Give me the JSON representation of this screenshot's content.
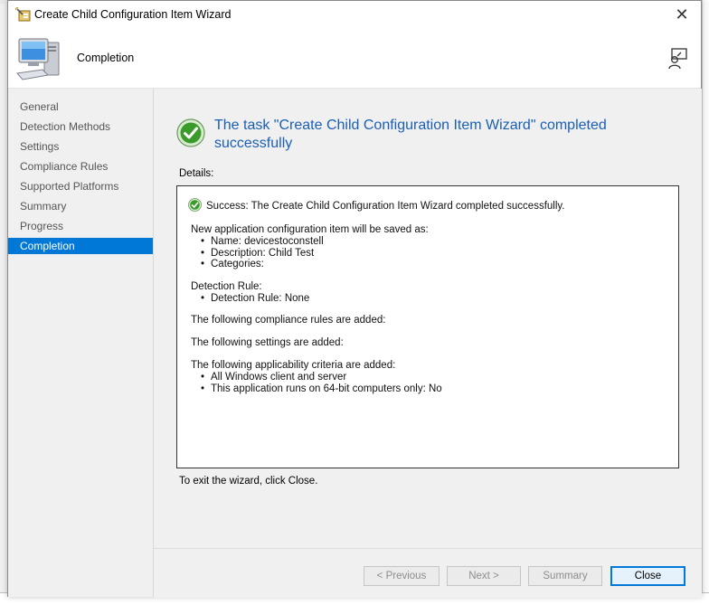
{
  "window": {
    "title": "Create Child Configuration Item Wizard",
    "close_glyph": "✕"
  },
  "header": {
    "page_title": "Completion"
  },
  "nav": {
    "items": [
      {
        "label": "General"
      },
      {
        "label": "Detection Methods"
      },
      {
        "label": "Settings"
      },
      {
        "label": "Compliance Rules"
      },
      {
        "label": "Supported Platforms"
      },
      {
        "label": "Summary"
      },
      {
        "label": "Progress"
      },
      {
        "label": "Completion",
        "active": true
      }
    ]
  },
  "main": {
    "status_title": "The task \"Create Child Configuration Item Wizard\" completed successfully",
    "details_label": "Details:",
    "details": {
      "success_text": "Success: The Create Child Configuration Item Wizard completed successfully.",
      "saved_as": {
        "heading": "New application configuration item will be saved as:",
        "items": [
          "Name: devicestoconstell",
          "Description: Child Test",
          "Categories:"
        ]
      },
      "detection": {
        "heading": "Detection Rule:",
        "items": [
          "Detection Rule: None"
        ]
      },
      "compliance_heading": "The following compliance rules are added:",
      "settings_heading": "The following settings are added:",
      "applicability": {
        "heading": "The following applicability criteria are added:",
        "items": [
          "All Windows client and server",
          "This application runs on 64-bit computers only: No"
        ]
      }
    },
    "exit_text": "To exit the wizard, click Close."
  },
  "footer": {
    "previous_label": "< Previous",
    "next_label": "Next >",
    "summary_label": "Summary",
    "close_label": "Close"
  },
  "icons": {
    "title": "wizard-icon",
    "header": "computer-icon",
    "help": "help-icon",
    "status": "success-check-icon"
  },
  "colors": {
    "accent": "#0078d7",
    "title_blue": "#1a5fb4",
    "success_green": "#3a9a2a"
  }
}
